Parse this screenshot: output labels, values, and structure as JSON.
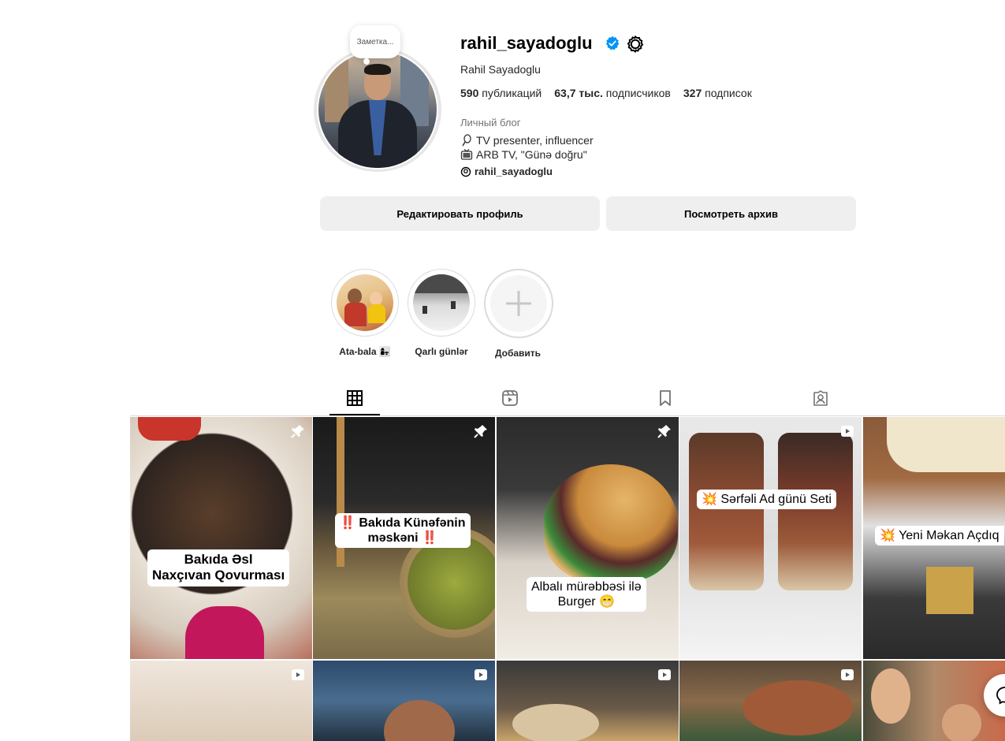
{
  "profile": {
    "note": "Заметка...",
    "username": "rahil_sayadoglu",
    "full_name": "Rahil Sayadoglu",
    "stats": {
      "posts_count": "590",
      "posts_label": "публикаций",
      "followers_count": "63,7 тыс.",
      "followers_label": "подписчиков",
      "following_count": "327",
      "following_label": "подписок"
    },
    "category": "Личный блог",
    "bio": [
      {
        "icon": "microphone-icon",
        "text": "TV presenter, influencer"
      },
      {
        "icon": "tv-icon",
        "text": "ARB TV, \"Günə doğru\""
      }
    ],
    "threads_handle": "rahil_sayadoglu"
  },
  "actions": {
    "edit_profile": "Редактировать профиль",
    "view_archive": "Посмотреть архив"
  },
  "highlights": [
    {
      "label": "Ata-bala 👩‍👧"
    },
    {
      "label": "Qarlı günlər"
    },
    {
      "label": "Добавить"
    }
  ],
  "tabs": [
    {
      "icon": "grid-icon",
      "active": true
    },
    {
      "icon": "reels-icon",
      "active": false
    },
    {
      "icon": "saved-icon",
      "active": false
    },
    {
      "icon": "tagged-icon",
      "active": false
    }
  ],
  "posts_row1": [
    {
      "caption": "Bakıda Əsl\nNaxçıvan Qovurması",
      "badge": "pin-icon"
    },
    {
      "caption": "‼️ Bakıda Künəfənin\nməskəni ‼️",
      "badge": "pin-icon"
    },
    {
      "caption": "Albalı mürəbbəsi ilə\nBurger 😁",
      "badge": "pin-icon"
    },
    {
      "caption": "💥 Sərfəli Ad günü Seti",
      "badge": "reel-icon"
    },
    {
      "caption": "💥 Yeni Məkan Açdıq",
      "badge": "none"
    }
  ],
  "posts_row2": [
    {
      "badge": "reel-icon"
    },
    {
      "badge": "reel-icon"
    },
    {
      "badge": "reel-icon"
    },
    {
      "badge": "reel-icon"
    },
    {
      "badge": "none"
    }
  ],
  "colors": {
    "verified_blue": "#0095f6",
    "button_bg": "#efefef",
    "border": "#dbdbdb",
    "muted_text": "#737373"
  }
}
